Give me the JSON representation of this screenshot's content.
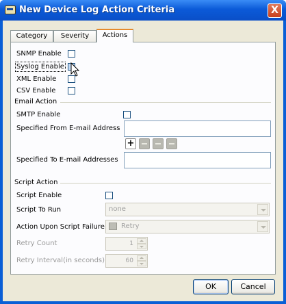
{
  "window": {
    "title": "New Device Log Action Criteria",
    "close_label": "X"
  },
  "tabs": [
    {
      "label": "Category"
    },
    {
      "label": "Severity"
    },
    {
      "label": "Actions"
    }
  ],
  "actions": {
    "snmp_enable": "SNMP Enable",
    "syslog_enable": "Syslog Enable",
    "xml_enable": "XML Enable",
    "csv_enable": "CSV Enable"
  },
  "email": {
    "section_label": "Email Action",
    "smtp_enable": "SMTP Enable",
    "from_label": "Specified From E-mail Address",
    "from_value": "",
    "to_label": "Specified To E-mail Addresses",
    "to_value": "",
    "add_glyph": "+"
  },
  "script": {
    "section_label": "Script Action",
    "script_enable": "Script Enable",
    "script_to_run_label": "Script To Run",
    "script_to_run_value": "none",
    "failure_label": "Action Upon Script Failure",
    "failure_value": "Retry",
    "retry_count_label": "Retry Count",
    "retry_count_value": "1",
    "retry_interval_label": "Retry Interval(in seconds)",
    "retry_interval_value": "60"
  },
  "buttons": {
    "ok": "OK",
    "cancel": "Cancel"
  }
}
